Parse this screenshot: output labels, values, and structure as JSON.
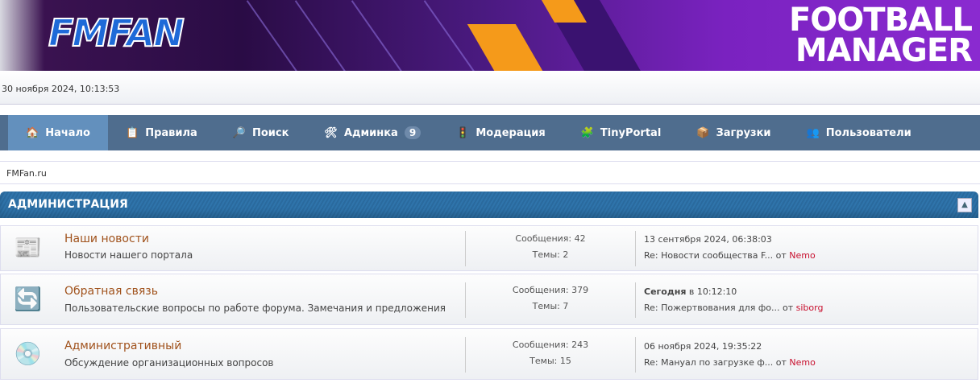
{
  "banner": {
    "site_logo": "FMFAN",
    "game_logo_line1": "FOOTBALL",
    "game_logo_line2": "MANAGER"
  },
  "datetime": "30 ноября 2024, 10:13:53",
  "nav": [
    {
      "label": "Начало",
      "icon": "home-icon"
    },
    {
      "label": "Правила",
      "icon": "clipboard-icon"
    },
    {
      "label": "Поиск",
      "icon": "search-icon"
    },
    {
      "label": "Админка",
      "icon": "tools-icon",
      "badge": "9"
    },
    {
      "label": "Модерация",
      "icon": "traffic-light-icon"
    },
    {
      "label": "TinyPortal",
      "icon": "blocks-icon"
    },
    {
      "label": "Загрузки",
      "icon": "box-icon"
    },
    {
      "label": "Пользователи",
      "icon": "users-icon"
    }
  ],
  "breadcrumb": "FMFan.ru",
  "category": {
    "title": "АДМИНИСТРАЦИЯ"
  },
  "boards": [
    {
      "name": "Наши новости",
      "desc": "Новости нашего  портала",
      "posts": "Сообщения: 42",
      "topics": "Темы: 2",
      "last_date": "13 сентября 2024, 06:38:03",
      "last_bold": "",
      "last_topic": "Re: Новости сообщества F...",
      "by": "от",
      "user": "Nemo"
    },
    {
      "name": "Обратная связь",
      "desc": "Пользовательские вопросы по работе форума. Замечания и предложения",
      "posts": "Сообщения: 379",
      "topics": "Темы: 7",
      "last_bold": "Сегодня",
      "last_date": "в 10:12:10",
      "last_topic": "Re: Пожертвования для фо...",
      "by": "от",
      "user": "siborg"
    },
    {
      "name": "Административный",
      "desc": "Обсуждение организационных вопросов",
      "posts": "Сообщения: 243",
      "topics": "Темы: 15",
      "last_date": "06 ноября 2024, 19:35:22",
      "last_bold": "",
      "last_topic": "Re: Мануал по загрузке ф...",
      "by": "от",
      "user": "Nemo"
    }
  ]
}
